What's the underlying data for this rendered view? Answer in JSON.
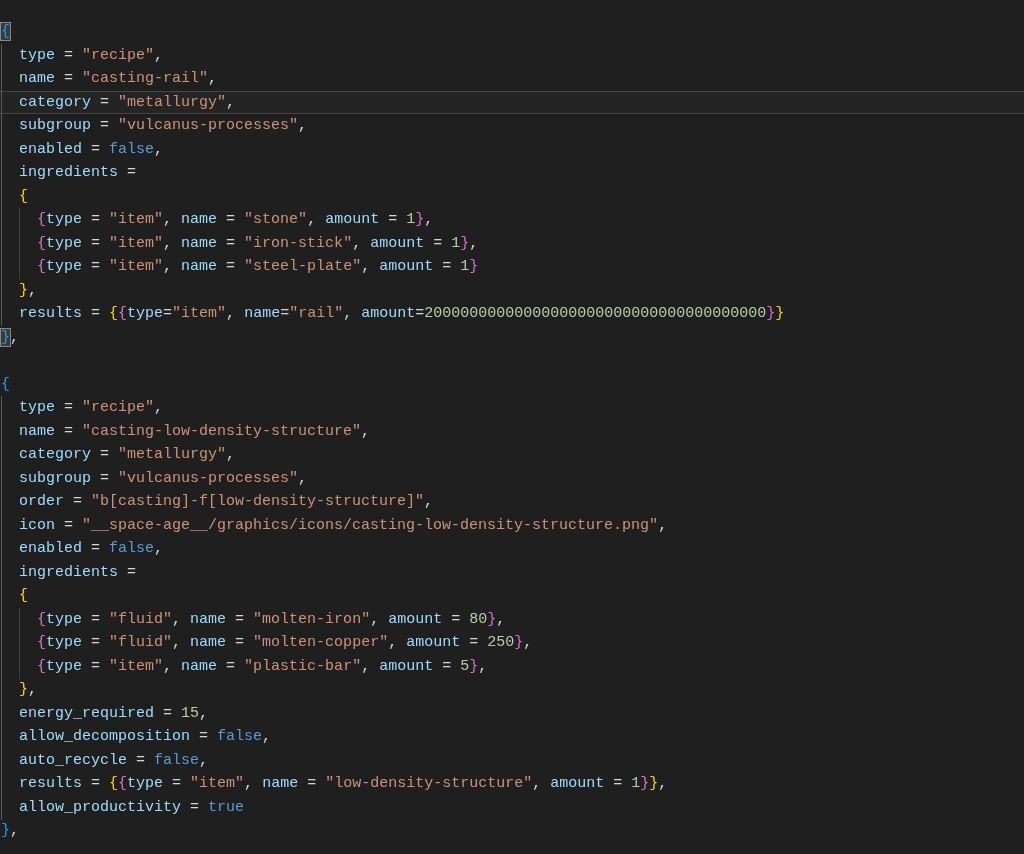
{
  "editor": {
    "lines": [
      {
        "current": false,
        "tokens": [
          {
            "kind": "bracket",
            "text": "{",
            "color": "#179fff",
            "matched": true
          }
        ]
      },
      {
        "current": false,
        "tokens": [
          {
            "kind": "key",
            "text": "  type"
          },
          {
            "kind": "punct",
            "text": " = "
          },
          {
            "kind": "string",
            "text": "\"recipe\""
          },
          {
            "kind": "punct",
            "text": ","
          }
        ]
      },
      {
        "current": false,
        "tokens": [
          {
            "kind": "key",
            "text": "  name"
          },
          {
            "kind": "punct",
            "text": " = "
          },
          {
            "kind": "string",
            "text": "\"casting-rail\""
          },
          {
            "kind": "punct",
            "text": ","
          }
        ]
      },
      {
        "current": true,
        "tokens": [
          {
            "kind": "key",
            "text": "  category"
          },
          {
            "kind": "punct",
            "text": " = "
          },
          {
            "kind": "string",
            "text": "\"metallurgy\""
          },
          {
            "kind": "punct",
            "text": ","
          }
        ]
      },
      {
        "current": false,
        "tokens": [
          {
            "kind": "key",
            "text": "  subgroup"
          },
          {
            "kind": "punct",
            "text": " = "
          },
          {
            "kind": "string",
            "text": "\"vulcanus-processes\""
          },
          {
            "kind": "punct",
            "text": ","
          }
        ]
      },
      {
        "current": false,
        "tokens": [
          {
            "kind": "key",
            "text": "  enabled"
          },
          {
            "kind": "punct",
            "text": " = "
          },
          {
            "kind": "keyword",
            "text": "false"
          },
          {
            "kind": "punct",
            "text": ","
          }
        ]
      },
      {
        "current": false,
        "tokens": [
          {
            "kind": "key",
            "text": "  ingredients"
          },
          {
            "kind": "punct",
            "text": " ="
          }
        ]
      },
      {
        "current": false,
        "tokens": [
          {
            "kind": "bracket",
            "text": "  {",
            "color": "#ffd700",
            "matched": false
          }
        ]
      },
      {
        "current": false,
        "tokens": [
          {
            "kind": "bracket",
            "text": "    {",
            "color": "#da70d6",
            "matched": false
          },
          {
            "kind": "key",
            "text": "type"
          },
          {
            "kind": "punct",
            "text": " = "
          },
          {
            "kind": "string",
            "text": "\"item\""
          },
          {
            "kind": "punct",
            "text": ", "
          },
          {
            "kind": "key",
            "text": "name"
          },
          {
            "kind": "punct",
            "text": " = "
          },
          {
            "kind": "string",
            "text": "\"stone\""
          },
          {
            "kind": "punct",
            "text": ", "
          },
          {
            "kind": "key",
            "text": "amount"
          },
          {
            "kind": "punct",
            "text": " = "
          },
          {
            "kind": "number",
            "text": "1"
          },
          {
            "kind": "bracket",
            "text": "}",
            "color": "#da70d6",
            "matched": false
          },
          {
            "kind": "punct",
            "text": ","
          }
        ]
      },
      {
        "current": false,
        "tokens": [
          {
            "kind": "bracket",
            "text": "    {",
            "color": "#da70d6",
            "matched": false
          },
          {
            "kind": "key",
            "text": "type"
          },
          {
            "kind": "punct",
            "text": " = "
          },
          {
            "kind": "string",
            "text": "\"item\""
          },
          {
            "kind": "punct",
            "text": ", "
          },
          {
            "kind": "key",
            "text": "name"
          },
          {
            "kind": "punct",
            "text": " = "
          },
          {
            "kind": "string",
            "text": "\"iron-stick\""
          },
          {
            "kind": "punct",
            "text": ", "
          },
          {
            "kind": "key",
            "text": "amount"
          },
          {
            "kind": "punct",
            "text": " = "
          },
          {
            "kind": "number",
            "text": "1"
          },
          {
            "kind": "bracket",
            "text": "}",
            "color": "#da70d6",
            "matched": false
          },
          {
            "kind": "punct",
            "text": ","
          }
        ]
      },
      {
        "current": false,
        "tokens": [
          {
            "kind": "bracket",
            "text": "    {",
            "color": "#da70d6",
            "matched": false
          },
          {
            "kind": "key",
            "text": "type"
          },
          {
            "kind": "punct",
            "text": " = "
          },
          {
            "kind": "string",
            "text": "\"item\""
          },
          {
            "kind": "punct",
            "text": ", "
          },
          {
            "kind": "key",
            "text": "name"
          },
          {
            "kind": "punct",
            "text": " = "
          },
          {
            "kind": "string",
            "text": "\"steel-plate\""
          },
          {
            "kind": "punct",
            "text": ", "
          },
          {
            "kind": "key",
            "text": "amount"
          },
          {
            "kind": "punct",
            "text": " = "
          },
          {
            "kind": "number",
            "text": "1"
          },
          {
            "kind": "bracket",
            "text": "}",
            "color": "#da70d6",
            "matched": false
          }
        ]
      },
      {
        "current": false,
        "tokens": [
          {
            "kind": "bracket",
            "text": "  }",
            "color": "#ffd700",
            "matched": false
          },
          {
            "kind": "punct",
            "text": ","
          }
        ]
      },
      {
        "current": false,
        "tokens": [
          {
            "kind": "key",
            "text": "  results"
          },
          {
            "kind": "punct",
            "text": " = "
          },
          {
            "kind": "bracket",
            "text": "{",
            "color": "#ffd700",
            "matched": false
          },
          {
            "kind": "bracket",
            "text": "{",
            "color": "#da70d6",
            "matched": false
          },
          {
            "kind": "key",
            "text": "type"
          },
          {
            "kind": "punct",
            "text": "="
          },
          {
            "kind": "string",
            "text": "\"item\""
          },
          {
            "kind": "punct",
            "text": ", "
          },
          {
            "kind": "key",
            "text": "name"
          },
          {
            "kind": "punct",
            "text": "="
          },
          {
            "kind": "string",
            "text": "\"rail\""
          },
          {
            "kind": "punct",
            "text": ", "
          },
          {
            "kind": "key",
            "text": "amount"
          },
          {
            "kind": "punct",
            "text": "="
          },
          {
            "kind": "number",
            "text": "20000000000000000000000000000000000000"
          },
          {
            "kind": "bracket",
            "text": "}",
            "color": "#da70d6",
            "matched": false
          },
          {
            "kind": "bracket",
            "text": "}",
            "color": "#ffd700",
            "matched": false
          }
        ]
      },
      {
        "current": false,
        "tokens": [
          {
            "kind": "bracket",
            "text": "}",
            "color": "#179fff",
            "matched": true
          },
          {
            "kind": "punct",
            "text": ","
          }
        ]
      },
      {
        "current": false
      },
      {
        "current": false,
        "tokens": [
          {
            "kind": "bracket",
            "text": "{",
            "color": "#179fff",
            "matched": false
          }
        ]
      },
      {
        "current": false,
        "tokens": [
          {
            "kind": "key",
            "text": "  type"
          },
          {
            "kind": "punct",
            "text": " = "
          },
          {
            "kind": "string",
            "text": "\"recipe\""
          },
          {
            "kind": "punct",
            "text": ","
          }
        ]
      },
      {
        "current": false,
        "tokens": [
          {
            "kind": "key",
            "text": "  name"
          },
          {
            "kind": "punct",
            "text": " = "
          },
          {
            "kind": "string",
            "text": "\"casting-low-density-structure\""
          },
          {
            "kind": "punct",
            "text": ","
          }
        ]
      },
      {
        "current": false,
        "tokens": [
          {
            "kind": "key",
            "text": "  category"
          },
          {
            "kind": "punct",
            "text": " = "
          },
          {
            "kind": "string",
            "text": "\"metallurgy\""
          },
          {
            "kind": "punct",
            "text": ","
          }
        ]
      },
      {
        "current": false,
        "tokens": [
          {
            "kind": "key",
            "text": "  subgroup"
          },
          {
            "kind": "punct",
            "text": " = "
          },
          {
            "kind": "string",
            "text": "\"vulcanus-processes\""
          },
          {
            "kind": "punct",
            "text": ","
          }
        ]
      },
      {
        "current": false,
        "tokens": [
          {
            "kind": "key",
            "text": "  order"
          },
          {
            "kind": "punct",
            "text": " = "
          },
          {
            "kind": "string",
            "text": "\"b[casting]-f[low-density-structure]\""
          },
          {
            "kind": "punct",
            "text": ","
          }
        ]
      },
      {
        "current": false,
        "tokens": [
          {
            "kind": "key",
            "text": "  icon"
          },
          {
            "kind": "punct",
            "text": " = "
          },
          {
            "kind": "string",
            "text": "\"__space-age__/graphics/icons/casting-low-density-structure.png\""
          },
          {
            "kind": "punct",
            "text": ","
          }
        ]
      },
      {
        "current": false,
        "tokens": [
          {
            "kind": "key",
            "text": "  enabled"
          },
          {
            "kind": "punct",
            "text": " = "
          },
          {
            "kind": "keyword",
            "text": "false"
          },
          {
            "kind": "punct",
            "text": ","
          }
        ]
      },
      {
        "current": false,
        "tokens": [
          {
            "kind": "key",
            "text": "  ingredients"
          },
          {
            "kind": "punct",
            "text": " ="
          }
        ]
      },
      {
        "current": false,
        "tokens": [
          {
            "kind": "bracket",
            "text": "  {",
            "color": "#ffd700",
            "matched": false
          }
        ]
      },
      {
        "current": false,
        "tokens": [
          {
            "kind": "bracket",
            "text": "    {",
            "color": "#da70d6",
            "matched": false
          },
          {
            "kind": "key",
            "text": "type"
          },
          {
            "kind": "punct",
            "text": " = "
          },
          {
            "kind": "string",
            "text": "\"fluid\""
          },
          {
            "kind": "punct",
            "text": ", "
          },
          {
            "kind": "key",
            "text": "name"
          },
          {
            "kind": "punct",
            "text": " = "
          },
          {
            "kind": "string",
            "text": "\"molten-iron\""
          },
          {
            "kind": "punct",
            "text": ", "
          },
          {
            "kind": "key",
            "text": "amount"
          },
          {
            "kind": "punct",
            "text": " = "
          },
          {
            "kind": "number",
            "text": "80"
          },
          {
            "kind": "bracket",
            "text": "}",
            "color": "#da70d6",
            "matched": false
          },
          {
            "kind": "punct",
            "text": ","
          }
        ]
      },
      {
        "current": false,
        "tokens": [
          {
            "kind": "bracket",
            "text": "    {",
            "color": "#da70d6",
            "matched": false
          },
          {
            "kind": "key",
            "text": "type"
          },
          {
            "kind": "punct",
            "text": " = "
          },
          {
            "kind": "string",
            "text": "\"fluid\""
          },
          {
            "kind": "punct",
            "text": ", "
          },
          {
            "kind": "key",
            "text": "name"
          },
          {
            "kind": "punct",
            "text": " = "
          },
          {
            "kind": "string",
            "text": "\"molten-copper\""
          },
          {
            "kind": "punct",
            "text": ", "
          },
          {
            "kind": "key",
            "text": "amount"
          },
          {
            "kind": "punct",
            "text": " = "
          },
          {
            "kind": "number",
            "text": "250"
          },
          {
            "kind": "bracket",
            "text": "}",
            "color": "#da70d6",
            "matched": false
          },
          {
            "kind": "punct",
            "text": ","
          }
        ]
      },
      {
        "current": false,
        "tokens": [
          {
            "kind": "bracket",
            "text": "    {",
            "color": "#da70d6",
            "matched": false
          },
          {
            "kind": "key",
            "text": "type"
          },
          {
            "kind": "punct",
            "text": " = "
          },
          {
            "kind": "string",
            "text": "\"item\""
          },
          {
            "kind": "punct",
            "text": ", "
          },
          {
            "kind": "key",
            "text": "name"
          },
          {
            "kind": "punct",
            "text": " = "
          },
          {
            "kind": "string",
            "text": "\"plastic-bar\""
          },
          {
            "kind": "punct",
            "text": ", "
          },
          {
            "kind": "key",
            "text": "amount"
          },
          {
            "kind": "punct",
            "text": " = "
          },
          {
            "kind": "number",
            "text": "5"
          },
          {
            "kind": "bracket",
            "text": "}",
            "color": "#da70d6",
            "matched": false
          },
          {
            "kind": "punct",
            "text": ","
          }
        ]
      },
      {
        "current": false,
        "tokens": [
          {
            "kind": "bracket",
            "text": "  }",
            "color": "#ffd700",
            "matched": false
          },
          {
            "kind": "punct",
            "text": ","
          }
        ]
      },
      {
        "current": false,
        "tokens": [
          {
            "kind": "key",
            "text": "  energy_required"
          },
          {
            "kind": "punct",
            "text": " = "
          },
          {
            "kind": "number",
            "text": "15"
          },
          {
            "kind": "punct",
            "text": ","
          }
        ]
      },
      {
        "current": false,
        "tokens": [
          {
            "kind": "key",
            "text": "  allow_decomposition"
          },
          {
            "kind": "punct",
            "text": " = "
          },
          {
            "kind": "keyword",
            "text": "false"
          },
          {
            "kind": "punct",
            "text": ","
          }
        ]
      },
      {
        "current": false,
        "tokens": [
          {
            "kind": "key",
            "text": "  auto_recycle"
          },
          {
            "kind": "punct",
            "text": " = "
          },
          {
            "kind": "keyword",
            "text": "false"
          },
          {
            "kind": "punct",
            "text": ","
          }
        ]
      },
      {
        "current": false,
        "tokens": [
          {
            "kind": "key",
            "text": "  results"
          },
          {
            "kind": "punct",
            "text": " = "
          },
          {
            "kind": "bracket",
            "text": "{",
            "color": "#ffd700",
            "matched": false
          },
          {
            "kind": "bracket",
            "text": "{",
            "color": "#da70d6",
            "matched": false
          },
          {
            "kind": "key",
            "text": "type"
          },
          {
            "kind": "punct",
            "text": " = "
          },
          {
            "kind": "string",
            "text": "\"item\""
          },
          {
            "kind": "punct",
            "text": ", "
          },
          {
            "kind": "key",
            "text": "name"
          },
          {
            "kind": "punct",
            "text": " = "
          },
          {
            "kind": "string",
            "text": "\"low-density-structure\""
          },
          {
            "kind": "punct",
            "text": ", "
          },
          {
            "kind": "key",
            "text": "amount"
          },
          {
            "kind": "punct",
            "text": " = "
          },
          {
            "kind": "number",
            "text": "1"
          },
          {
            "kind": "bracket",
            "text": "}",
            "color": "#da70d6",
            "matched": false
          },
          {
            "kind": "bracket",
            "text": "}",
            "color": "#ffd700",
            "matched": false
          },
          {
            "kind": "punct",
            "text": ","
          }
        ]
      },
      {
        "current": false,
        "tokens": [
          {
            "kind": "key",
            "text": "  allow_productivity"
          },
          {
            "kind": "punct",
            "text": " = "
          },
          {
            "kind": "keyword",
            "text": "true"
          }
        ]
      },
      {
        "current": false,
        "tokens": [
          {
            "kind": "bracket",
            "text": "}",
            "color": "#179fff",
            "matched": false
          },
          {
            "kind": "punct",
            "text": ","
          }
        ]
      }
    ]
  }
}
